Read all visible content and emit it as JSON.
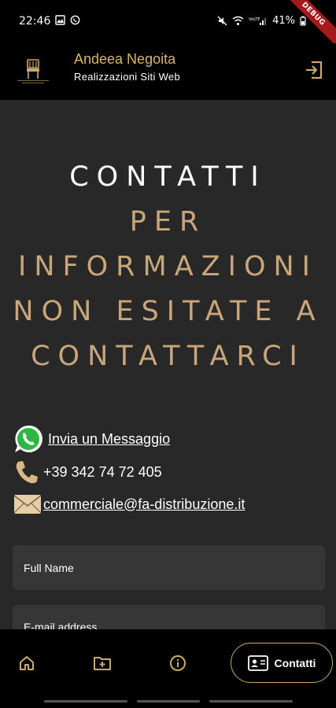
{
  "status_bar": {
    "time": "22:46",
    "battery": "41%",
    "debug_label": "DEBUG"
  },
  "app_bar": {
    "title": "Andeea Negoita",
    "subtitle": "Realizzazioni Siti Web",
    "accent_color": "#d8b66a"
  },
  "heading": {
    "line1": "CONTATTI",
    "line2": "PER",
    "line3": "INFORMAZIONI",
    "line4": "NON ESITATE A",
    "line5": "CONTATTARCI"
  },
  "contacts": {
    "whatsapp_label": "Invia un Messaggio",
    "phone": "+39 342 74 72 405",
    "email": "commerciale@fa-distribuzione.it"
  },
  "form": {
    "full_name_placeholder": "Full Name",
    "email_placeholder": "E-mail address"
  },
  "bottom_nav": {
    "active_label": "Contatti",
    "items": [
      "home-icon",
      "folder-add-icon",
      "info-icon",
      "contact-card-icon"
    ]
  }
}
